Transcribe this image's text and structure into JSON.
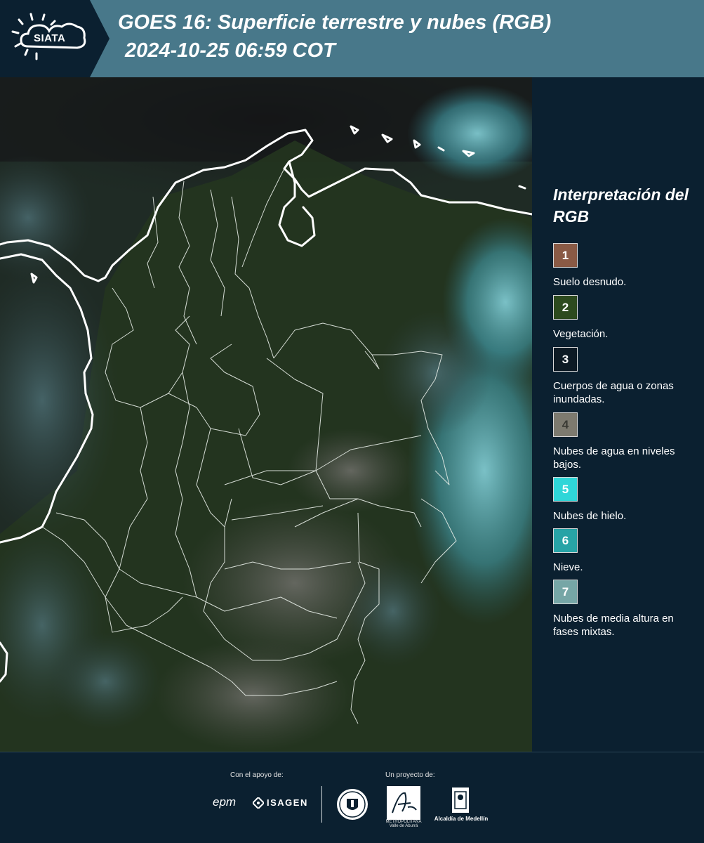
{
  "header": {
    "logo_text": "SIATA",
    "title_line1": "GOES 16: Superficie terrestre y nubes (RGB)",
    "title_line2": "2024-10-25 06:59 COT"
  },
  "legend": {
    "title": "Interpretación del RGB",
    "items": [
      {
        "number": "1",
        "label": "Suelo desnudo.",
        "color": "#8a5a45"
      },
      {
        "number": "2",
        "label": "Vegetación.",
        "color": "#2d4a1e"
      },
      {
        "number": "3",
        "label": "Cuerpos de agua o zonas inundadas.",
        "color": "#0d1a24"
      },
      {
        "number": "4",
        "label": "Nubes de agua en niveles bajos.",
        "color": "#7d7a6f"
      },
      {
        "number": "5",
        "label": "Nubes de hielo.",
        "color": "#2fd6d8"
      },
      {
        "number": "6",
        "label": "Nieve.",
        "color": "#27a3a6"
      },
      {
        "number": "7",
        "label": "Nubes de media altura en fases mixtas.",
        "color": "#76a6a6"
      }
    ]
  },
  "footer": {
    "support_caption": "Con el apoyo de:",
    "project_caption": "Un proyecto de:",
    "sponsors": [
      "epm",
      "ISAGEN"
    ],
    "partner_area": "METROPOLITANA Valle de Aburrá",
    "partner_alcaldia": "Alcaldía de Medellín"
  }
}
